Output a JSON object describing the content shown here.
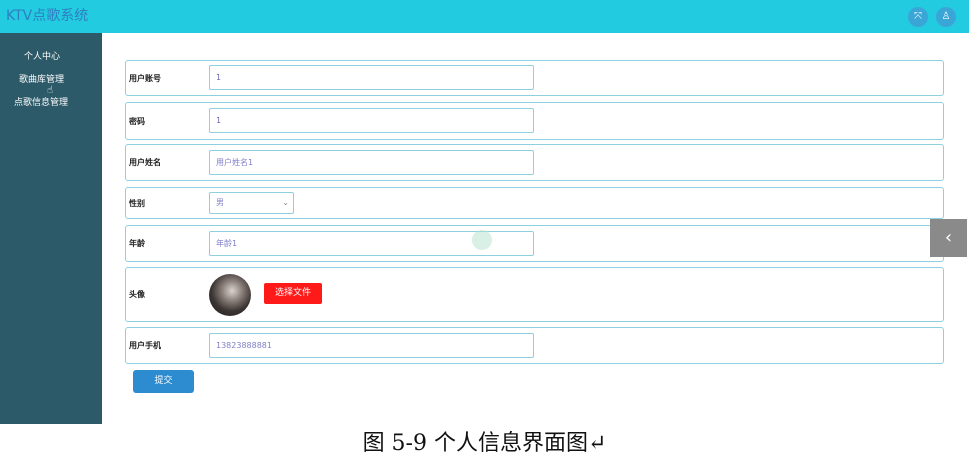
{
  "app": {
    "title": "KTV点歌系统"
  },
  "topbar": {
    "fullscreen_icon": "⤧",
    "user_icon": "♙"
  },
  "sidebar": {
    "items": [
      {
        "label": "个人中心"
      },
      {
        "label": "歌曲库管理"
      },
      {
        "label": "点歌信息管理"
      }
    ]
  },
  "form": {
    "account": {
      "label": "用户账号",
      "value": "1"
    },
    "password": {
      "label": "密码",
      "value": "1"
    },
    "name": {
      "label": "用户姓名",
      "placeholder": "用户姓名1"
    },
    "gender": {
      "label": "性别",
      "value": "男"
    },
    "age": {
      "label": "年龄",
      "placeholder": "年龄1"
    },
    "avatar": {
      "label": "头像",
      "button_label": "选择文件"
    },
    "phone": {
      "label": "用户手机",
      "value": "13823888881"
    },
    "submit_label": "提交"
  },
  "side_tab": {
    "icon": "chevron-left-icon"
  },
  "caption": "图 5-9 个人信息界面图↵"
}
